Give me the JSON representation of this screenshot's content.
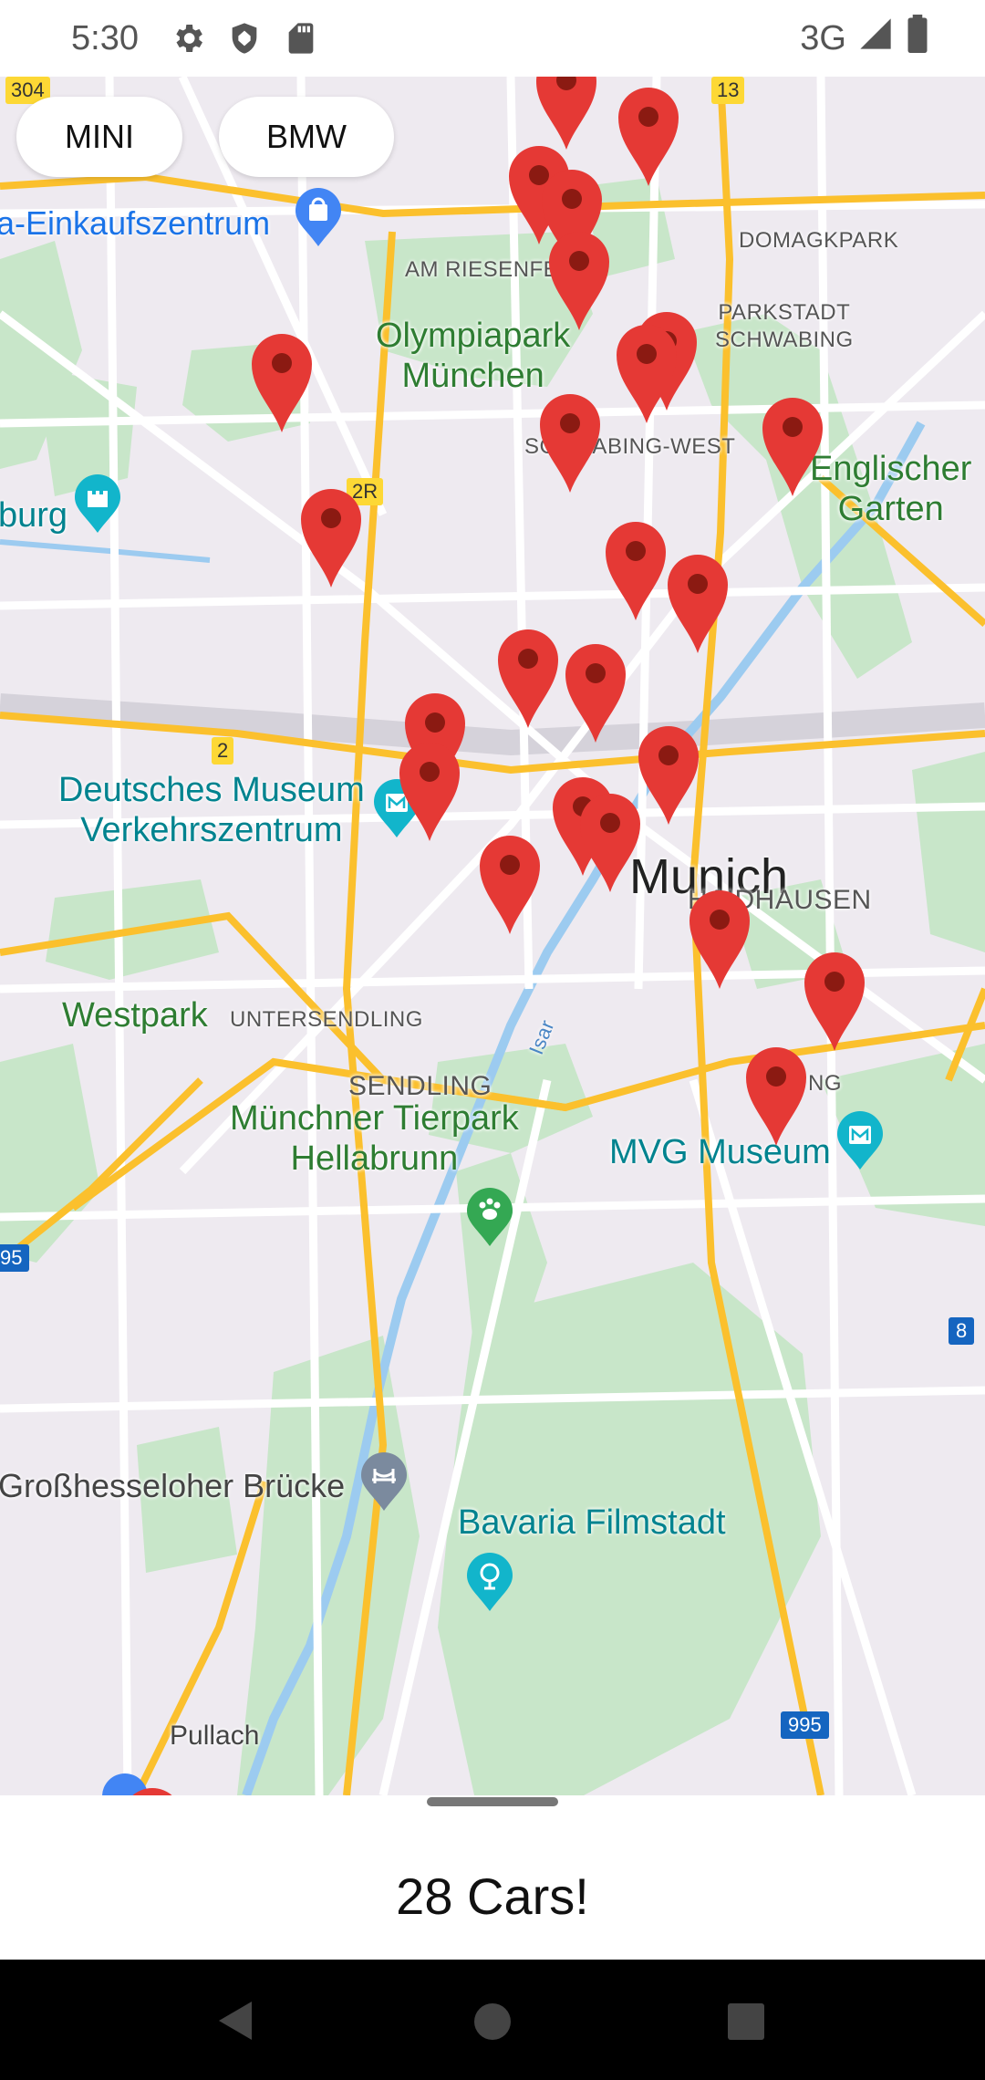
{
  "status_bar": {
    "time": "5:30",
    "network": "3G",
    "icons": [
      "settings-icon",
      "shield-icon",
      "sd-card-icon",
      "signal-icon",
      "battery-icon"
    ]
  },
  "filters": {
    "chips": [
      {
        "label": "MINI"
      },
      {
        "label": "BMW"
      }
    ]
  },
  "map": {
    "city_label": "Munich",
    "labels": {
      "einkauf": "a-Einkaufszentrum",
      "domagkpark": "DOMAGKPARK",
      "am_riesenfeld": "AM RIESENFELD",
      "olympiapark": "Olympiapark\nMünchen",
      "parkstadt": "PARKSTADT\nSCHWABING",
      "schwabing_west": "SCHWABING-WEST",
      "englischer_garten": "Englischer\nGarten",
      "burg": "burg",
      "deutsches_museum": "Deutsches Museum\nVerkehrszentrum",
      "haidhausen": "HAIDHAUSEN",
      "westpark": "Westpark",
      "untersendling": "UNTERSENDLING",
      "sendling": "SENDLING",
      "tierpark": "Münchner Tierpark\nHellabrunn",
      "mvg_museum": "MVG Museum",
      "isar": "Isar",
      "grosshesseloher": "Großhesseloher Brücke",
      "bavaria_filmstadt": "Bavaria Filmstadt",
      "pullach": "Pullach",
      "ng_fragment": "NG"
    },
    "road_shields": {
      "r304": "304",
      "r13": "13",
      "r2r": "2R",
      "r2": "2",
      "r95": "95",
      "r8": "8",
      "r995": "995"
    },
    "marker_count": 28
  },
  "sheet": {
    "title": "28 Cars!"
  },
  "colors": {
    "pin_red": "#e53935",
    "pin_dot": "#8b1a12",
    "map_background": "#eeeaf0",
    "park_green": "#c8e6c9",
    "road_yellow": "#fbc02d",
    "water_blue": "#9ccbf0"
  }
}
